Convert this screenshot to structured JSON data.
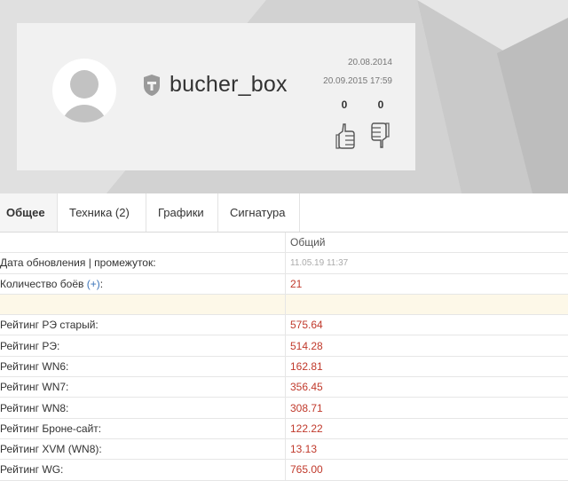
{
  "profile": {
    "nickname": "bucher_box",
    "date_registered": "20.08.2014",
    "date_last_battle": "20.09.2015 17:59",
    "likes": "0",
    "dislikes": "0"
  },
  "tabs": [
    {
      "label": "Общее"
    },
    {
      "label": "Техника (2)"
    },
    {
      "label": "Графики"
    },
    {
      "label": "Сигнатура"
    }
  ],
  "table": {
    "header": "Общий",
    "rows": [
      {
        "label": "Дата обновления | промежуток:",
        "value": "11.05.19 11:37"
      },
      {
        "label": "Количество боёв",
        "label_suffix": ":",
        "plus": "(+)",
        "value": "21"
      },
      {
        "label": "",
        "value": ""
      },
      {
        "label": "Рейтинг РЭ старый:",
        "value": "575.64"
      },
      {
        "label": "Рейтинг РЭ:",
        "value": "514.28"
      },
      {
        "label": "Рейтинг WN6:",
        "value": "162.81"
      },
      {
        "label": "Рейтинг WN7:",
        "value": "356.45"
      },
      {
        "label": "Рейтинг WN8:",
        "value": "308.71"
      },
      {
        "label": "Рейтинг Броне-сайт:",
        "value": "122.22"
      },
      {
        "label": "Рейтинг XVM (WN8):",
        "value": "13.13"
      },
      {
        "label": "Рейтинг WG:",
        "value": "765.00"
      }
    ]
  },
  "icons": {
    "avatar": "user-avatar-placeholder",
    "tank": "wot-tank-emblem-icon",
    "like": "thumbs-up-icon",
    "dislike": "thumbs-down-icon"
  }
}
